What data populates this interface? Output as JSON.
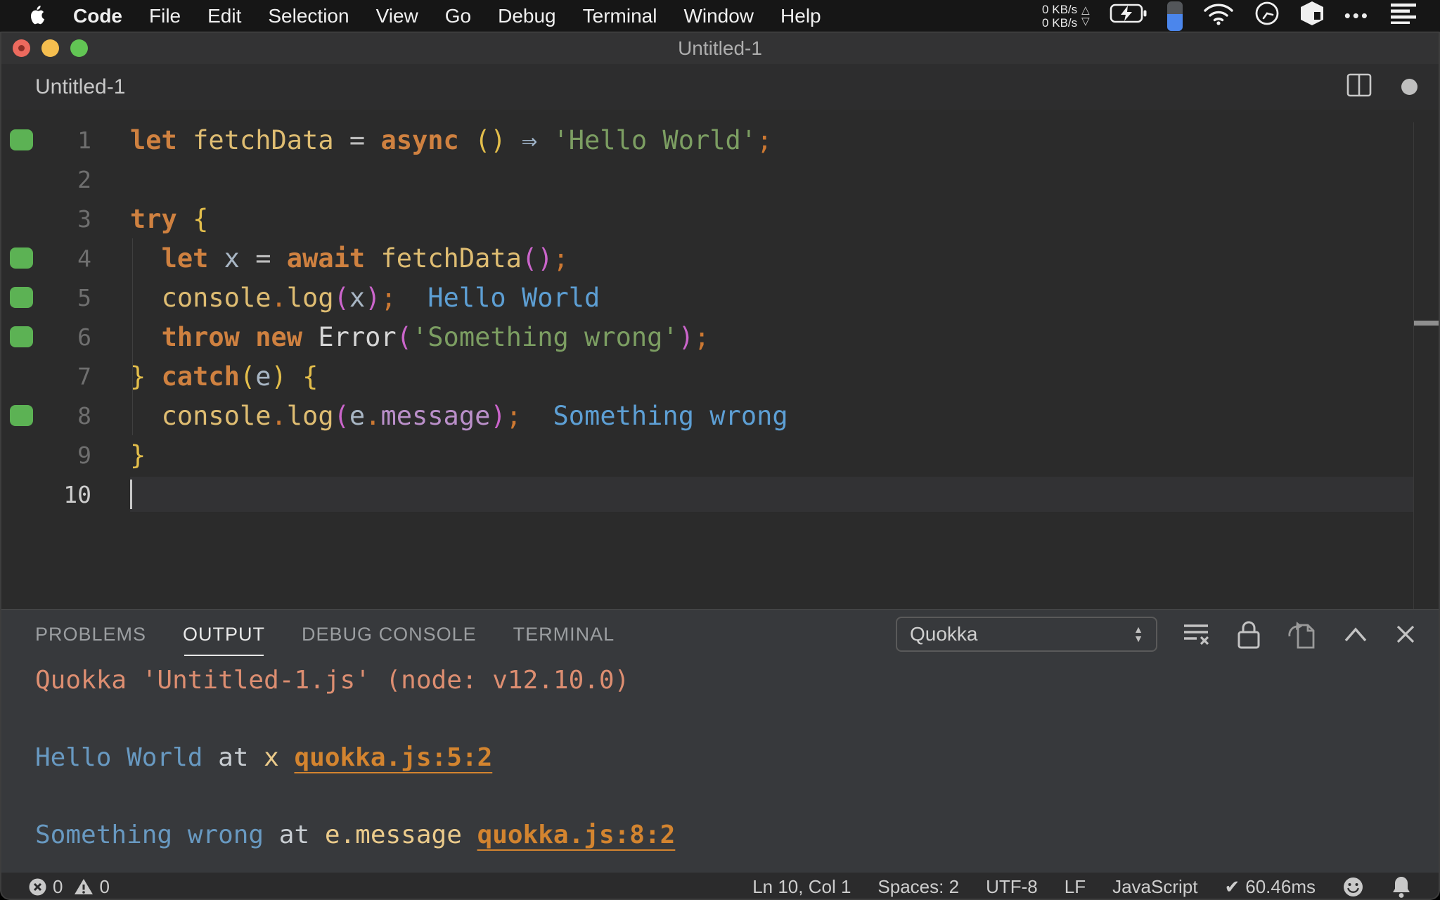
{
  "colors": {
    "quokka_green": "#5CB254",
    "traffic_red": "#EC6A5E",
    "traffic_yellow": "#F5BE4F",
    "traffic_green": "#62C554",
    "output_link_orange": "#D3842F",
    "inline_value_blue": "#5D9FD4",
    "output_salmon": "#DD8E71",
    "editor_bg": "#2B2B2B",
    "panel_bg": "#37393C"
  },
  "icons": {
    "net_up_arrow": "△",
    "net_down_arrow": "▽",
    "dropdown_up": "▲",
    "dropdown_down": "▼",
    "overflow_dots": "•••"
  },
  "menu_bar": {
    "items": [
      "Code",
      "File",
      "Edit",
      "Selection",
      "View",
      "Go",
      "Debug",
      "Terminal",
      "Window",
      "Help"
    ],
    "net_up": "0 KB/s",
    "net_down": "0 KB/s"
  },
  "window": {
    "title": "Untitled-1",
    "tab_label": "Untitled-1"
  },
  "editor": {
    "current_line": 10,
    "lines": [
      {
        "num": "1",
        "mark": true,
        "tokens": [
          {
            "t": "let ",
            "c": "kw"
          },
          {
            "t": "fetchData ",
            "c": "id"
          },
          {
            "t": "= ",
            "c": "op"
          },
          {
            "t": "async ",
            "c": "kw"
          },
          {
            "t": "() ",
            "c": "p1"
          },
          {
            "t": "⇒ ",
            "c": "arrow"
          },
          {
            "t": "'Hello World'",
            "c": "str"
          },
          {
            "t": ";",
            "c": "punc"
          }
        ]
      },
      {
        "num": "2",
        "mark": false,
        "tokens": []
      },
      {
        "num": "3",
        "mark": false,
        "tokens": [
          {
            "t": "try ",
            "c": "kw"
          },
          {
            "t": "{",
            "c": "p1"
          }
        ]
      },
      {
        "num": "4",
        "mark": true,
        "tokens": [
          {
            "t": "  ",
            "c": "ws"
          },
          {
            "t": "let ",
            "c": "kw"
          },
          {
            "t": "x ",
            "c": "var"
          },
          {
            "t": "= ",
            "c": "op"
          },
          {
            "t": "await ",
            "c": "kw"
          },
          {
            "t": "fetchData",
            "c": "id"
          },
          {
            "t": "()",
            "c": "p2"
          },
          {
            "t": ";",
            "c": "punc"
          }
        ]
      },
      {
        "num": "5",
        "mark": true,
        "tokens": [
          {
            "t": "  ",
            "c": "ws"
          },
          {
            "t": "console",
            "c": "id"
          },
          {
            "t": ".",
            "c": "punc"
          },
          {
            "t": "log",
            "c": "id"
          },
          {
            "t": "(",
            "c": "p2"
          },
          {
            "t": "x",
            "c": "var"
          },
          {
            "t": ")",
            "c": "p2"
          },
          {
            "t": ";",
            "c": "punc"
          },
          {
            "t": "  Hello World",
            "c": "qval"
          }
        ]
      },
      {
        "num": "6",
        "mark": true,
        "tokens": [
          {
            "t": "  ",
            "c": "ws"
          },
          {
            "t": "throw ",
            "c": "kw"
          },
          {
            "t": "new ",
            "c": "kw"
          },
          {
            "t": "Error",
            "c": "cls"
          },
          {
            "t": "(",
            "c": "p2"
          },
          {
            "t": "'Something wrong'",
            "c": "str"
          },
          {
            "t": ")",
            "c": "p2"
          },
          {
            "t": ";",
            "c": "punc"
          }
        ]
      },
      {
        "num": "7",
        "mark": false,
        "tokens": [
          {
            "t": "} ",
            "c": "p1"
          },
          {
            "t": "catch",
            "c": "kw"
          },
          {
            "t": "(",
            "c": "p1"
          },
          {
            "t": "e",
            "c": "var"
          },
          {
            "t": ") ",
            "c": "p1"
          },
          {
            "t": "{",
            "c": "p1"
          }
        ]
      },
      {
        "num": "8",
        "mark": true,
        "tokens": [
          {
            "t": "  ",
            "c": "ws"
          },
          {
            "t": "console",
            "c": "id"
          },
          {
            "t": ".",
            "c": "punc"
          },
          {
            "t": "log",
            "c": "id"
          },
          {
            "t": "(",
            "c": "p2"
          },
          {
            "t": "e",
            "c": "var"
          },
          {
            "t": ".",
            "c": "punc"
          },
          {
            "t": "message",
            "c": "prop"
          },
          {
            "t": ")",
            "c": "p2"
          },
          {
            "t": ";",
            "c": "punc"
          },
          {
            "t": "  Something wrong",
            "c": "qval"
          }
        ]
      },
      {
        "num": "9",
        "mark": false,
        "tokens": [
          {
            "t": "}",
            "c": "p1"
          }
        ]
      },
      {
        "num": "10",
        "mark": false,
        "tokens": []
      }
    ]
  },
  "panel": {
    "tabs": [
      {
        "label": "PROBLEMS",
        "active": false
      },
      {
        "label": "OUTPUT",
        "active": true
      },
      {
        "label": "DEBUG CONSOLE",
        "active": false
      },
      {
        "label": "TERMINAL",
        "active": false
      }
    ],
    "dropdown_value": "Quokka",
    "output_lines": [
      {
        "tokens": [
          {
            "t": "Quokka 'Untitled-1.js' (node: v12.10.0)",
            "c": "salmon"
          }
        ]
      },
      {
        "tokens": [
          {
            "t": "Hello World",
            "c": "blue"
          },
          {
            "t": " at ",
            "c": "gray"
          },
          {
            "t": "x ",
            "c": "tan"
          },
          {
            "t": "quokka.js:5:2",
            "c": "link"
          }
        ]
      },
      {
        "tokens": [
          {
            "t": "Something wrong",
            "c": "blue"
          },
          {
            "t": " at ",
            "c": "gray"
          },
          {
            "t": "e.message ",
            "c": "tan"
          },
          {
            "t": "quokka.js:8:2",
            "c": "link"
          }
        ]
      }
    ]
  },
  "status_bar": {
    "errors": "0",
    "warnings": "0",
    "line_col": "Ln 10, Col 1",
    "spaces": "Spaces: 2",
    "encoding": "UTF-8",
    "eol": "LF",
    "language": "JavaScript",
    "check": "✔",
    "time": "60.46ms"
  }
}
